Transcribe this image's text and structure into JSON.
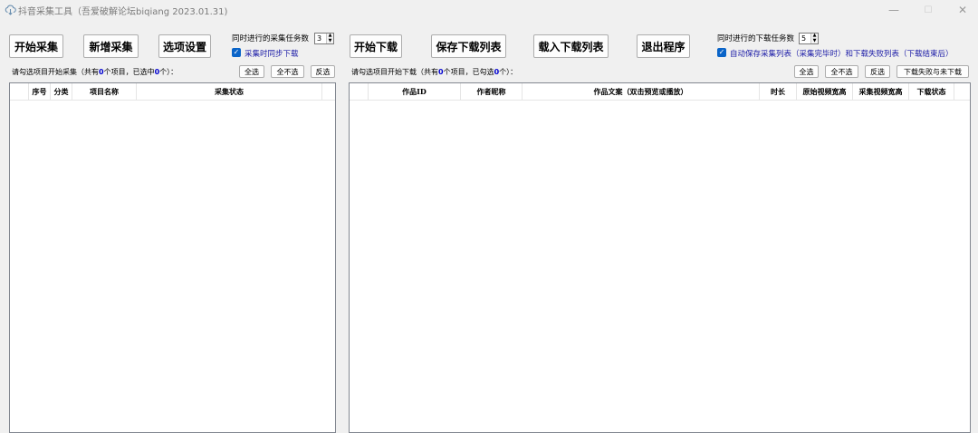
{
  "window": {
    "title": "抖音采集工具（吾爱破解论坛biqiang 2023.01.31)",
    "min_glyph": "—",
    "max_glyph": "☐",
    "close_glyph": "✕"
  },
  "toolbar": {
    "start_collect": "开始采集",
    "new_collect": "新增采集",
    "options": "选项设置",
    "start_download": "开始下载",
    "save_download_list": "保存下载列表",
    "load_download_list": "载入下载列表",
    "exit": "退出程序"
  },
  "collect_settings": {
    "concurrent_label": "同时进行的采集任务数",
    "concurrent_value": "3",
    "sync_download_label": "采集时同步下载",
    "sync_download_checked": true
  },
  "download_settings": {
    "concurrent_label": "同时进行的下载任务数",
    "concurrent_value": "5",
    "auto_save_label": "自动保存采集列表（采集完毕时）和下载失败列表（下载结束后）",
    "auto_save_checked": true
  },
  "collect_panel": {
    "hint_prefix": "请勾选项目开始采集（共有",
    "total": "0",
    "hint_mid": "个项目，已选中",
    "selected": "0",
    "hint_suffix": "个）：",
    "select_all": "全选",
    "select_none": "全不选",
    "invert": "反选",
    "columns": [
      "",
      "序号",
      "分类",
      "项目名称",
      "采集状态",
      ""
    ]
  },
  "download_panel": {
    "hint_prefix": "请勾选项目开始下载（共有",
    "total": "0",
    "hint_mid": "个项目，已勾选",
    "selected": "0",
    "hint_suffix": "个）：",
    "select_all": "全选",
    "select_none": "全不选",
    "invert": "反选",
    "failed_or_pending": "下载失败与未下载",
    "columns": [
      "",
      "作品ID",
      "作者昵称",
      "作品文案（双击预览或播放）",
      "时长",
      "原始视频宽高",
      "采集视频宽高",
      "下载状态",
      ""
    ]
  },
  "icons": {
    "app": "cloud-download-icon",
    "checkmark": "✓",
    "spin_up": "▲",
    "spin_down": "▼"
  }
}
